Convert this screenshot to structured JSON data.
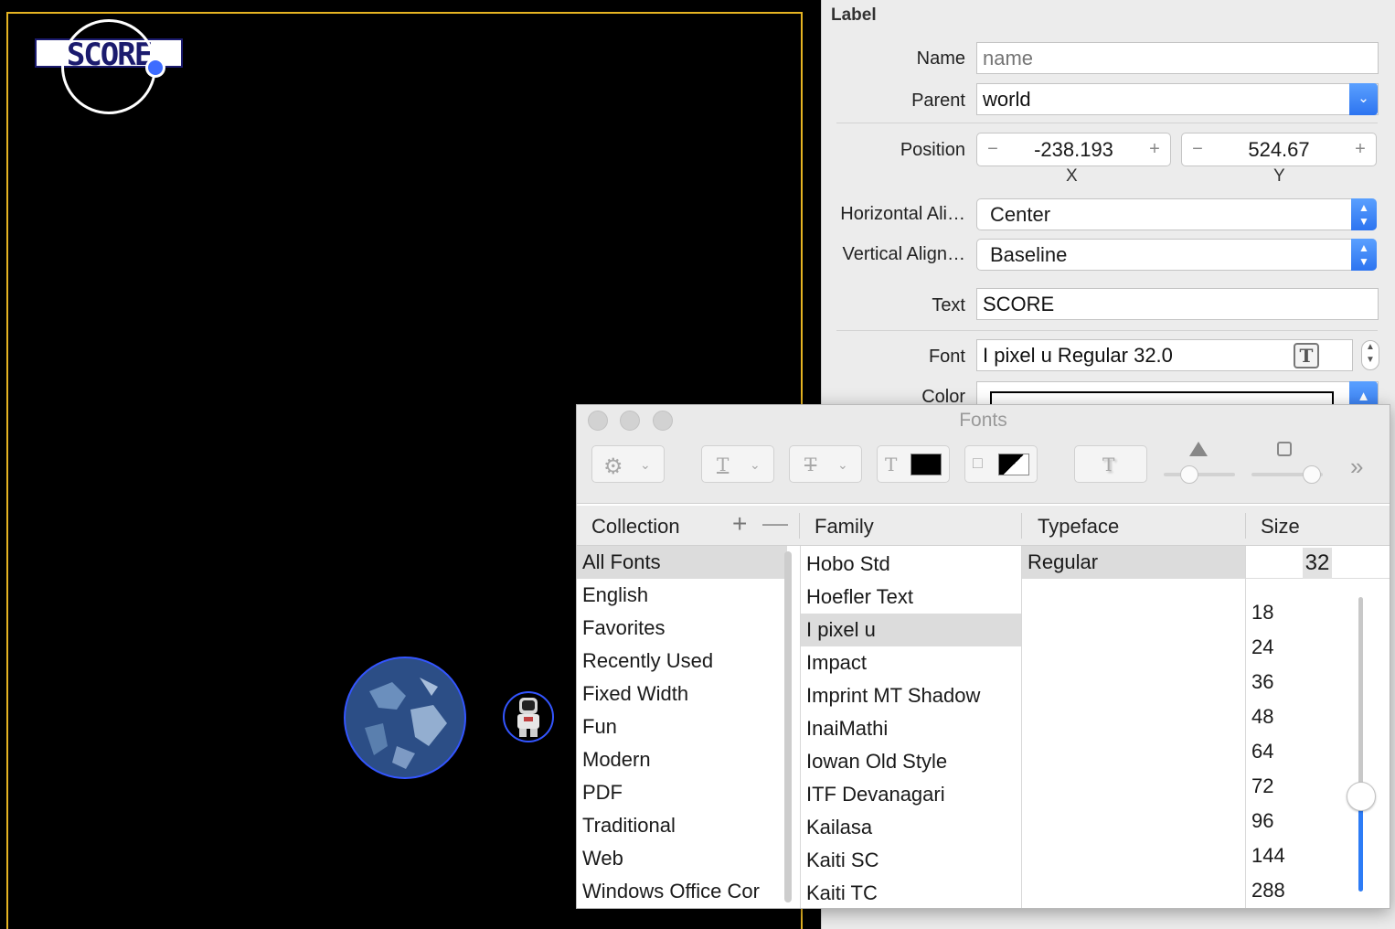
{
  "scene": {
    "score_label_text": "SCORE",
    "border_color": "#e6b422",
    "background_color": "#000000"
  },
  "inspector": {
    "header": "Label",
    "name_label": "Name",
    "name_placeholder": "name",
    "parent_label": "Parent",
    "parent_value": "world",
    "position_label": "Position",
    "position_x": "-238.193",
    "position_y": "524.67",
    "x_label": "X",
    "y_label": "Y",
    "stepper_minus": "−",
    "stepper_plus": "+",
    "halign_label": "Horizontal Ali…",
    "halign_value": "Center",
    "valign_label": "Vertical Align…",
    "valign_value": "Baseline",
    "text_label": "Text",
    "text_value": "SCORE",
    "font_label": "Font",
    "font_value": "I pixel u Regular 32.0",
    "font_icon_glyph": "T",
    "color_label": "Color"
  },
  "fonts_panel": {
    "title": "Fonts",
    "more_glyph": "»",
    "headers": {
      "collection": "Collection",
      "family": "Family",
      "typeface": "Typeface",
      "size": "Size"
    },
    "collections": [
      "All Fonts",
      "English",
      "Favorites",
      "Recently Used",
      "Fixed Width",
      "Fun",
      "Modern",
      "PDF",
      "Traditional",
      "Web",
      "Windows Office Cor"
    ],
    "selected_collection": 0,
    "families": [
      "Hobo Std",
      "Hoefler Text",
      "I pixel u",
      "Impact",
      "Imprint MT Shadow",
      "InaiMathi",
      "Iowan Old Style",
      "ITF Devanagari",
      "Kailasa",
      "Kaiti SC",
      "Kaiti TC"
    ],
    "selected_family": 2,
    "typefaces": [
      "Regular"
    ],
    "selected_typeface": 0,
    "size_value": "32",
    "sizes": [
      "18",
      "24",
      "36",
      "48",
      "64",
      "72",
      "96",
      "144",
      "288"
    ],
    "accent_color": "#2d7cf6"
  }
}
